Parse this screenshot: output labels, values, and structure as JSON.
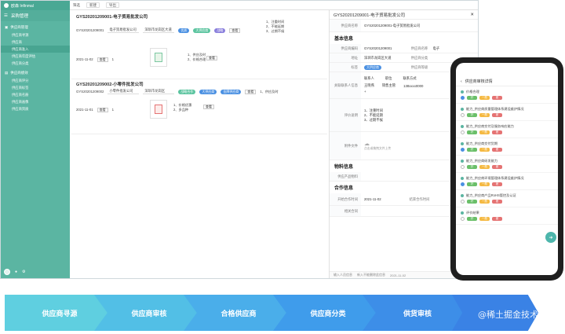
{
  "app": {
    "name": "欧森 Infinmal",
    "module": "采购管理"
  },
  "sidebar": {
    "section1": "供应商管理",
    "items1": [
      "供应商寻源",
      "供应商",
      "供应商准入",
      "供应商年度评估",
      "供应商分类"
    ],
    "section2": "供应商绩效",
    "items2": [
      "供应商评分",
      "供应商标签",
      "供应商名册",
      "供应商画像",
      "供应商资质"
    ]
  },
  "toolbar": {
    "filter": "筛选",
    "create": "新建",
    "import": "导出"
  },
  "cards": [
    {
      "title": "GYS20201209001-电子贸易批发公司",
      "code": "GYS20201209001",
      "company": "电子贸易批发公司",
      "address": "深圳市龙岗区大道",
      "tags": [
        "优质",
        "大供应商",
        "战略"
      ],
      "btn": "查看",
      "list": [
        "1、注重时间",
        "2、不能延期",
        "3、过期不候"
      ],
      "date": "2021-11-02",
      "count": "1",
      "btn2": "查看",
      "list2": [
        "1、供应及时",
        "2、价格合理"
      ],
      "btn3": "查看"
    },
    {
      "title": "GYS20201209002-小零件批发公司",
      "code": "GYS20201209002",
      "company": "小零件批发公司",
      "address": "深圳市龙岗区",
      "tags": [
        "战略合作",
        "大供应商",
        "金牌供应商"
      ],
      "btn": "查看",
      "list": [
        "1、供应及时"
      ],
      "date": "2021-11-01",
      "count": "1",
      "btn2": "查看",
      "list2": [
        "1、价格优惠",
        "2、多品种"
      ],
      "btn3": "查看"
    }
  ],
  "detail": {
    "title": "GYS20201209001-电子贸易批发公司",
    "section_basic": "基本信息",
    "rows": [
      {
        "label": "供应商编码",
        "value": "GYS20201209001",
        "label2": "供应商名称",
        "value2": "电子"
      },
      {
        "label": "地址",
        "value": "深圳市龙岗区大道",
        "label2": "供应商分类",
        "value2": ""
      },
      {
        "label": "标签",
        "value": "大供应商",
        "label2": "供应商等级",
        "value2": ""
      }
    ],
    "contact_label": "关联联系人信息",
    "contact_headers": [
      "联系人",
      "职位",
      "联系方式"
    ],
    "contact_row": [
      "王晓燕",
      "销售主管",
      "138xxxx0000"
    ],
    "eval_label": "评价说明",
    "eval_list": [
      "1、注重时间",
      "2、不能延期",
      "3、过期不候"
    ],
    "attach_label": "附件文件",
    "upload_text": "点击或拖拽文件上传",
    "section_material": "物料信息",
    "material_label": "供应产品物料",
    "section_coop": "合作信息",
    "coop_label": "开始合作时间",
    "coop_value": "2021-11-02",
    "coop_label2": "结束合作时间",
    "contract_label": "相关合同",
    "footer": [
      "输入人员信息",
      "新入不能删除此信息",
      "2021-11-02"
    ]
  },
  "phone": {
    "header": "供应商审核详情",
    "items": [
      {
        "q": "价格合理",
        "selected": true
      },
      {
        "q": "能力_供应商质量管理体系建设维护情况",
        "selected": false
      },
      {
        "q": "能力_供应商交付及服务响应能力",
        "selected": false
      },
      {
        "q": "能力_供应商交付货期",
        "selected": true
      },
      {
        "q": "能力_供应商研发能力",
        "selected": false
      },
      {
        "q": "能力_供应商环境管理体系建设维护情况",
        "selected": true
      },
      {
        "q": "能力_供应商产品RoHS管控及认证",
        "selected": false
      },
      {
        "q": "评价结果",
        "selected": false
      }
    ],
    "options": [
      "好",
      "一般",
      "差"
    ]
  },
  "flow": [
    "供应商寻源",
    "供应商审核",
    "合格供应商",
    "供应商分类",
    "供货审核"
  ],
  "colors": {
    "sidebar": "#5bb5a2",
    "flow": [
      "#5fcfe0",
      "#52bfe6",
      "#4aaeea",
      "#3f9ceb",
      "#3d8ee8",
      "#3a82e5"
    ]
  },
  "watermark": "@稀土掘金技术社区"
}
